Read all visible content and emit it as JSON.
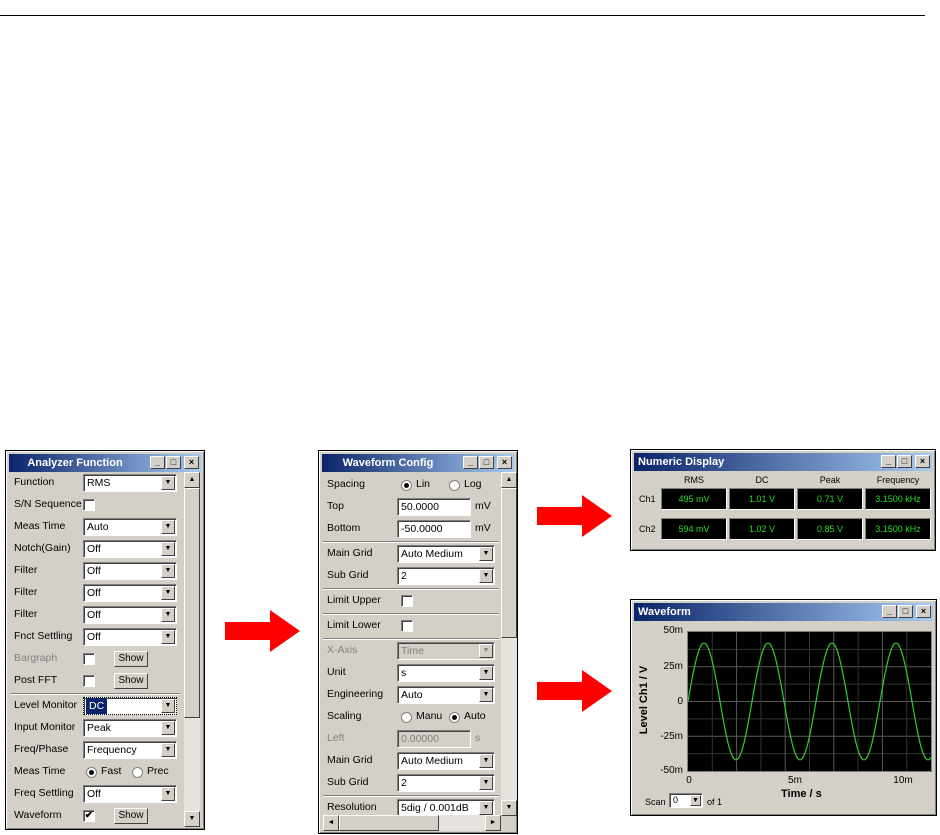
{
  "analyzer": {
    "title": "Analyzer Function",
    "rows": {
      "function": {
        "label": "Function",
        "value": "RMS"
      },
      "sn_sequence": {
        "label": "S/N Sequence"
      },
      "meas_time": {
        "label": "Meas Time",
        "value": "Auto"
      },
      "notch": {
        "label": "Notch(Gain)",
        "value": "Off"
      },
      "filter1": {
        "label": "Filter",
        "value": "Off"
      },
      "filter2": {
        "label": "Filter",
        "value": "Off"
      },
      "filter3": {
        "label": "Filter",
        "value": "Off"
      },
      "fnct_settling": {
        "label": "Fnct Settling",
        "value": "Off"
      },
      "bargraph": {
        "label": "Bargraph",
        "button": "Show"
      },
      "post_fft": {
        "label": "Post FFT",
        "button": "Show"
      },
      "level_monitor": {
        "label": "Level Monitor",
        "value": "DC"
      },
      "input_monitor": {
        "label": "Input Monitor",
        "value": "Peak"
      },
      "freq_phase": {
        "label": "Freq/Phase",
        "value": "Frequency"
      },
      "meas_time2": {
        "label": "Meas Time",
        "opt1": "Fast",
        "opt2": "Prec"
      },
      "freq_settling": {
        "label": "Freq Settling",
        "value": "Off"
      },
      "waveform": {
        "label": "Waveform",
        "check": "✔",
        "button": "Show"
      }
    }
  },
  "waveform_config": {
    "title": "Waveform Config",
    "rows": {
      "spacing": {
        "label": "Spacing",
        "opt1": "Lin",
        "opt2": "Log"
      },
      "top": {
        "label": "Top",
        "value": "50.0000",
        "unit": "mV"
      },
      "bottom": {
        "label": "Bottom",
        "value": "-50.0000",
        "unit": "mV"
      },
      "main_grid": {
        "label": "Main Grid",
        "value": "Auto Medium"
      },
      "sub_grid": {
        "label": "Sub Grid",
        "value": "2"
      },
      "limit_upper": {
        "label": "Limit Upper"
      },
      "limit_lower": {
        "label": "Limit Lower"
      },
      "x_axis": {
        "label": "X-Axis",
        "value": "Time"
      },
      "unit": {
        "label": "Unit",
        "value": "s"
      },
      "engineering": {
        "label": "Engineering",
        "value": "Auto"
      },
      "scaling": {
        "label": "Scaling",
        "opt1": "Manu",
        "opt2": "Auto"
      },
      "left": {
        "label": "Left",
        "value": "0.00000",
        "unit": "s"
      },
      "main_grid2": {
        "label": "Main Grid",
        "value": "Auto Medium"
      },
      "sub_grid2": {
        "label": "Sub Grid",
        "value": "2"
      },
      "resolution": {
        "label": "Resolution",
        "value": "5dig / 0.001dB"
      }
    }
  },
  "numeric_display": {
    "title": "Numeric Display",
    "columns": [
      "RMS",
      "DC",
      "Peak",
      "Frequency"
    ],
    "rows": [
      {
        "label": "Ch1",
        "values": [
          "495 mV",
          "1.01 V",
          "0.71 V",
          "3.1500 kHz"
        ]
      },
      {
        "label": "Ch2",
        "values": [
          "594 mV",
          "1.02 V",
          "0.85 V",
          "3.1500 kHz"
        ]
      }
    ]
  },
  "waveform_window": {
    "title": "Waveform",
    "y_axis_label": "Level Ch1 / V",
    "x_axis_label": "Time / s",
    "y_ticks": [
      "50m",
      "25m",
      "0",
      "-25m",
      "-50m"
    ],
    "x_ticks": [
      "0",
      "5m",
      "10m"
    ],
    "scan_label": "Scan",
    "scan_value": "0",
    "scan_of": "of 1",
    "trace_color": "#33cc33"
  },
  "window_buttons": {
    "min": "_",
    "max": "□",
    "close": "×"
  },
  "scroll_arrows": {
    "up": "▲",
    "down": "▼",
    "left": "◄",
    "right": "►",
    "dropdown": "▼"
  },
  "arrow_color": "#ff0000"
}
